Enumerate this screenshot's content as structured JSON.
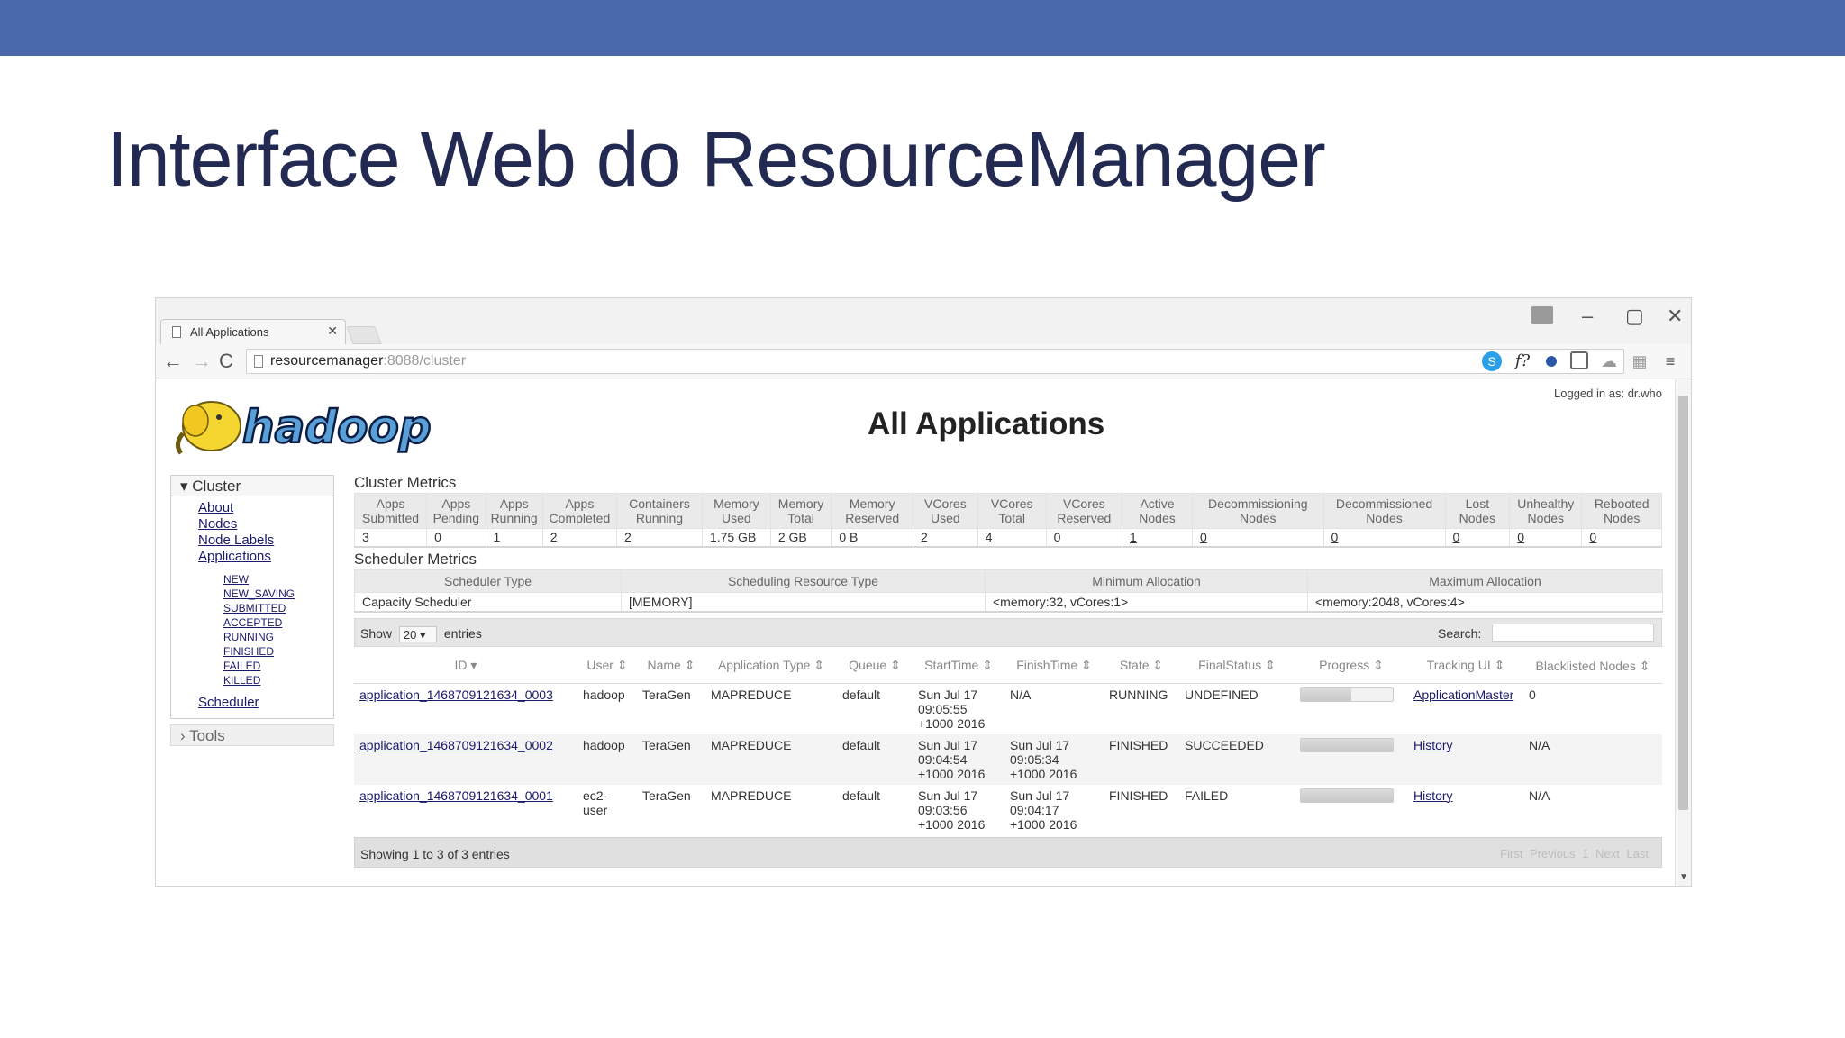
{
  "slide": {
    "title": "Interface Web do ResourceManager"
  },
  "browser": {
    "tab_title": "All Applications",
    "url_host": "resourcemanager",
    "url_rest": ":8088/cluster",
    "icons": [
      "back-icon",
      "forward-icon",
      "reload-icon",
      "page-icon",
      "skype-icon",
      "fx-icon",
      "extension-icon",
      "box-icon",
      "cloud-icon",
      "grid-icon",
      "menu-icon"
    ]
  },
  "page": {
    "logged_in": "Logged in as: dr.who",
    "heading": "All Applications",
    "logo_text": "hadoop"
  },
  "sidebar": {
    "cluster_label": "Cluster",
    "links": [
      "About",
      "Nodes",
      "Node Labels",
      "Applications"
    ],
    "app_states": [
      "NEW",
      "NEW_SAVING",
      "SUBMITTED",
      "ACCEPTED",
      "RUNNING",
      "FINISHED",
      "FAILED",
      "KILLED"
    ],
    "scheduler": "Scheduler",
    "tools_label": "Tools"
  },
  "cluster_metrics": {
    "title": "Cluster Metrics",
    "headers": [
      [
        "Apps",
        "Submitted"
      ],
      [
        "Apps",
        "Pending"
      ],
      [
        "Apps",
        "Running"
      ],
      [
        "Apps",
        "Completed"
      ],
      [
        "Containers",
        "Running"
      ],
      [
        "Memory",
        "Used"
      ],
      [
        "Memory",
        "Total"
      ],
      [
        "Memory",
        "Reserved"
      ],
      [
        "VCores",
        "Used"
      ],
      [
        "VCores",
        "Total"
      ],
      [
        "VCores",
        "Reserved"
      ],
      [
        "Active",
        "Nodes"
      ],
      [
        "Decommissioning",
        "Nodes"
      ],
      [
        "Decommissioned",
        "Nodes"
      ],
      [
        "Lost",
        "Nodes"
      ],
      [
        "Unhealthy",
        "Nodes"
      ],
      [
        "Rebooted",
        "Nodes"
      ]
    ],
    "values": [
      "3",
      "0",
      "1",
      "2",
      "2",
      "1.75 GB",
      "2 GB",
      "0 B",
      "2",
      "4",
      "0",
      "1",
      "0",
      "0",
      "0",
      "0",
      "0"
    ]
  },
  "scheduler_metrics": {
    "title": "Scheduler Metrics",
    "headers": [
      "Scheduler Type",
      "Scheduling Resource Type",
      "Minimum Allocation",
      "Maximum Allocation"
    ],
    "values": [
      "Capacity Scheduler",
      "[MEMORY]",
      "<memory:32, vCores:1>",
      "<memory:2048, vCores:4>"
    ]
  },
  "datatable": {
    "show_label": "Show",
    "show_value": "20",
    "entries_label": "entries",
    "search_label": "Search:",
    "info": "Showing 1 to 3 of 3 entries",
    "pager": "First Previous 1 Next Last",
    "headers": [
      "ID",
      "User",
      "Name",
      "Application Type",
      "Queue",
      "StartTime",
      "FinishTime",
      "State",
      "FinalStatus",
      "Progress",
      "Tracking UI",
      "Blacklisted Nodes"
    ],
    "rows": [
      {
        "id": "application_1468709121634_0003",
        "user": "hadoop",
        "name": "TeraGen",
        "type": "MAPREDUCE",
        "queue": "default",
        "start": [
          "Sun Jul 17",
          "09:05:55",
          "+1000 2016"
        ],
        "finish": [
          "N/A",
          "",
          ""
        ],
        "state": "RUNNING",
        "final_status": "UNDEFINED",
        "progress": 0.55,
        "tracking": "ApplicationMaster",
        "blacklisted": "0"
      },
      {
        "id": "application_1468709121634_0002",
        "user": "hadoop",
        "name": "TeraGen",
        "type": "MAPREDUCE",
        "queue": "default",
        "start": [
          "Sun Jul 17",
          "09:04:54",
          "+1000 2016"
        ],
        "finish": [
          "Sun Jul 17",
          "09:05:34",
          "+1000 2016"
        ],
        "state": "FINISHED",
        "final_status": "SUCCEEDED",
        "progress": 1.0,
        "tracking": "History",
        "blacklisted": "N/A"
      },
      {
        "id": "application_1468709121634_0001",
        "user": "ec2-user",
        "name": "TeraGen",
        "type": "MAPREDUCE",
        "queue": "default",
        "start": [
          "Sun Jul 17",
          "09:03:56",
          "+1000 2016"
        ],
        "finish": [
          "Sun Jul 17",
          "09:04:17",
          "+1000 2016"
        ],
        "state": "FINISHED",
        "final_status": "FAILED",
        "progress": 1.0,
        "tracking": "History",
        "blacklisted": "N/A"
      }
    ]
  },
  "colors": {
    "topbar": "#4a69ad",
    "title": "#232a52",
    "link": "#1a1a6b"
  }
}
